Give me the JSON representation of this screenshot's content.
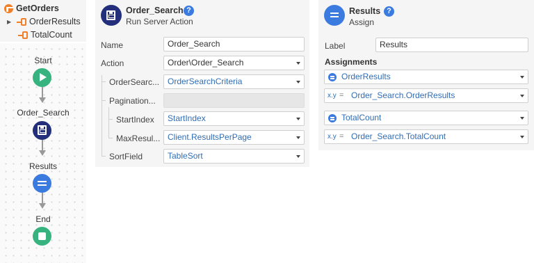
{
  "tree": {
    "root": "GetOrders",
    "children": [
      "OrderResults",
      "TotalCount"
    ]
  },
  "flow": {
    "nodes": [
      "Start",
      "Order_Search",
      "Results",
      "End"
    ]
  },
  "server_action": {
    "title": "Order_Search",
    "subtitle": "Run Server Action",
    "rows": [
      {
        "label": "Name",
        "value": "Order_Search",
        "dropdown": false
      },
      {
        "label": "Action",
        "value": "Order\\Order_Search",
        "dropdown": true
      },
      {
        "label": "OrderSearc...",
        "value": "OrderSearchCriteria",
        "dropdown": true
      },
      {
        "label": "Pagination...",
        "value": "",
        "dropdown": false
      },
      {
        "label": "StartIndex",
        "value": "StartIndex",
        "dropdown": true
      },
      {
        "label": "MaxResul...",
        "value": "Client.ResultsPerPage",
        "dropdown": true
      },
      {
        "label": "SortField",
        "value": "TableSort",
        "dropdown": true
      }
    ]
  },
  "assign": {
    "title": "Results",
    "subtitle": "Assign",
    "label_caption": "Label",
    "label_value": "Results",
    "assignments_title": "Assignments",
    "eq_sign": "=",
    "xy": "x.y",
    "items": [
      {
        "variable": "OrderResults",
        "value": "Order_Search.OrderResults"
      },
      {
        "variable": "TotalCount",
        "value": "Order_Search.TotalCount"
      }
    ]
  },
  "help_glyph": "?",
  "colors": {
    "start_end": "#36b37e",
    "server_node": "#232f7a",
    "assign_node": "#3b7be0",
    "action_icon": "#f07f2a",
    "link_text": "#2f6db5"
  }
}
